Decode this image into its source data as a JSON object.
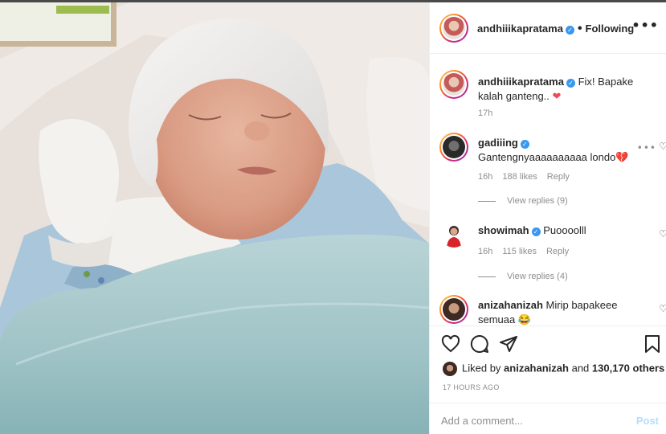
{
  "post": {
    "image_icon": "newborn-baby-photo"
  },
  "header": {
    "username": "andhiiikapratama",
    "verified_icon": "verified-badge-icon",
    "separator": "•",
    "follow_label": "Following",
    "more_icon": "•••"
  },
  "caption": {
    "username": "andhiiikapratama",
    "text": "Fix! Bapake kalah ganteng..",
    "emoji": "❤",
    "time": "17h"
  },
  "comments": [
    {
      "username": "gadiiing",
      "verified": true,
      "text": "Gantengnyaaaaaaaaaa londo💔",
      "time": "16h",
      "likes": "188 likes",
      "reply": "Reply",
      "view_replies": "View replies (9)"
    },
    {
      "username": "showimah",
      "verified": true,
      "text": "Puoooolll",
      "time": "16h",
      "likes": "115 likes",
      "reply": "Reply",
      "view_replies": "View replies (4)"
    },
    {
      "username": "anizahanizah",
      "verified": false,
      "text": "Mirip bapakeee semuaa 😂"
    }
  ],
  "actions": {
    "liked_by_prefix": "Liked by",
    "liked_by_user": "anizahanizah",
    "liked_by_and": "and",
    "liked_by_count": "130,170 others",
    "time_ago": "17 HOURS AGO"
  },
  "composer": {
    "placeholder": "Add a comment...",
    "post_label": "Post"
  },
  "colors": {
    "verified": "#3897f0",
    "like_red": "#ed4956",
    "post_disabled": "#b2dffc",
    "secondary_text": "#8e8e8e"
  }
}
